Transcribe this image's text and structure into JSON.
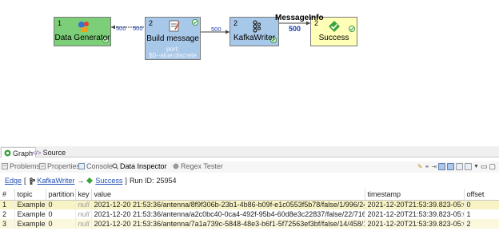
{
  "graph": {
    "nodes": {
      "generator": {
        "num": "1",
        "label": "Data Generator",
        "icon": "data-generator-icon"
      },
      "build": {
        "num": "2",
        "label": "Build message",
        "sub1": "port:",
        "sub2": "$0--alue:discrete",
        "icon": "script-icon"
      },
      "kafka": {
        "num": "2",
        "label": "KafkaWriter",
        "icon": "kafka-icon"
      },
      "success": {
        "num": "2",
        "label": "Success",
        "icon": "success-check-icon"
      }
    },
    "edges": {
      "gen_out": "500",
      "build_in": "500",
      "build_out": "500",
      "kafka_in": "500",
      "meta_label": "MessageInfo",
      "meta_count": "500"
    },
    "colors": {
      "generator": "#7ccf78",
      "transformer": "#a8c8ea",
      "success": "#ffffb8",
      "edge_count": "#1a3ea8"
    }
  },
  "editor_tabs": {
    "graph": "Graph",
    "source": "Source"
  },
  "views": {
    "problems": "Problems",
    "properties": "Properties",
    "console": "Console",
    "data_inspector": "Data Inspector",
    "regex": "Regex Tester"
  },
  "inspector": {
    "edge_label": "Edge",
    "open_bracket": "[",
    "from": "KafkaWriter",
    "arrow": "→",
    "to": "Success",
    "close_bracket": "]",
    "run_label": "Run ID:",
    "run_id": "25954"
  },
  "table": {
    "columns": [
      "#",
      "topic",
      "partition",
      "key",
      "value",
      "timestamp",
      "offset"
    ],
    "rows": [
      [
        "1",
        "Example",
        "0",
        "null",
        "2021-12-20 21:53:36/antenna/8f9f306b-23b1-4b86-b09f-e1c0553f5b78/false/1/996/247",
        "2021-12-20T21:53:39.823-05:00",
        "0"
      ],
      [
        "2",
        "Example",
        "0",
        "null",
        "2021-12-20 21:53:36/antenna/a2c0bc40-0ca4-492f-95b4-60d8e3c22837/false/22/716/206",
        "2021-12-20T21:53:39.823-05:00",
        "1"
      ],
      [
        "3",
        "Example",
        "0",
        "null",
        "2021-12-20 21:53:36/antenna/7a1a739c-5848-48e3-b6f1-5f72563ef3bf/false/14/458/126",
        "2021-12-20T21:53:39.823-05:00",
        "2"
      ]
    ]
  }
}
